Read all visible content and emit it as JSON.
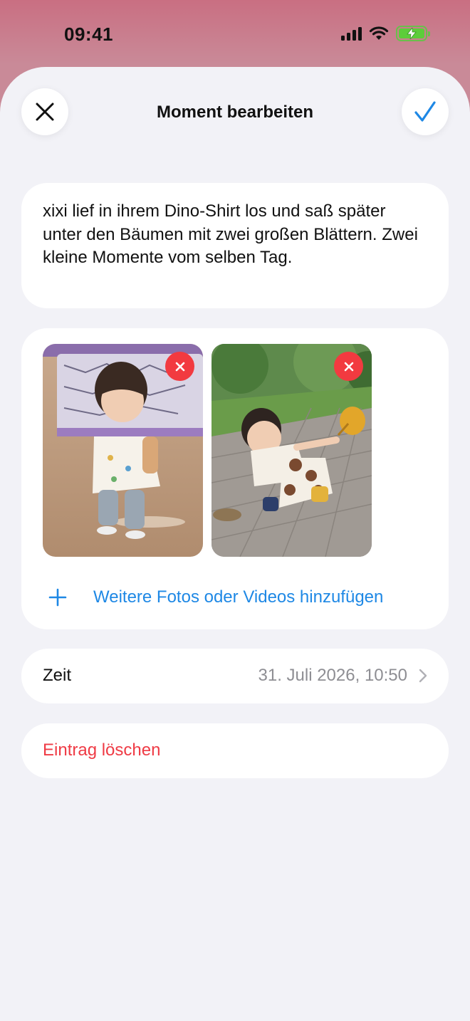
{
  "status_bar": {
    "time": "09:41",
    "icons": [
      "cellular-signal-icon",
      "wifi-icon",
      "battery-charging-icon"
    ],
    "battery_color": "#5ccd3a"
  },
  "nav": {
    "title": "Moment bearbeiten",
    "close_icon": "close-icon",
    "done_icon": "checkmark-icon",
    "accent_color": "#1e88e5"
  },
  "description": {
    "text": "xixi lief in ihrem Dino-Shirt los und saß später unter den Bäumen mit zwei großen Blättern. Zwei kleine Momente vom selben Tag."
  },
  "media": {
    "items": [
      {
        "subject": "Kleinkind im Dino-Shirt in einem Einkaufszentrum",
        "remove_icon": "remove-icon"
      },
      {
        "subject": "Kleinkind sitzt auf Pflastersteinen mit einem gelben Blatt",
        "remove_icon": "remove-icon"
      }
    ],
    "add_label": "Weitere Fotos oder Videos hinzufügen",
    "add_icon": "plus-icon",
    "remove_color": "#f23a40"
  },
  "time_row": {
    "label": "Zeit",
    "value": "31. Juli 2026, 10:50",
    "icon": "chevron-right-icon"
  },
  "delete_row": {
    "label": "Eintrag löschen",
    "color": "#ef3b45"
  }
}
